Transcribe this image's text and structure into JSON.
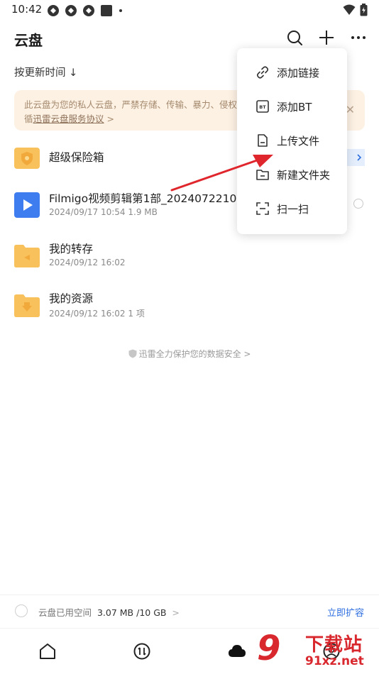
{
  "status_bar": {
    "time": "10:42"
  },
  "header": {
    "title": "云盘",
    "sort_label": "按更新时间 ↓"
  },
  "notice": {
    "line1": "此云盘为您的私人云盘，严禁存储、传输、暴力、侵权等",
    "line2_prefix": "循",
    "line2_link": "迅雷云盘服务协议",
    "line2_suffix": " >"
  },
  "files": [
    {
      "name": "超级保险箱",
      "meta": ""
    },
    {
      "name": "Filmigo视频剪辑第1部_202407221017",
      "meta": "2024/09/17 10:54  1.9 MB"
    },
    {
      "name": "我的转存",
      "meta": "2024/09/12 16:02"
    },
    {
      "name": "我的资源",
      "meta": "2024/09/12 16:02  1 项"
    }
  ],
  "secure_text": "迅雷全力保护您的数据安全 >",
  "menu": {
    "items": [
      {
        "label": "添加链接",
        "icon": "link-icon"
      },
      {
        "label": "添加BT",
        "icon": "bt-icon"
      },
      {
        "label": "上传文件",
        "icon": "upload-file-icon"
      },
      {
        "label": "新建文件夹",
        "icon": "new-folder-icon"
      },
      {
        "label": "扫一扫",
        "icon": "scan-icon"
      }
    ]
  },
  "storage": {
    "label": "云盘已用空间",
    "used": "3.07 MB /10 GB",
    "chevron": ">",
    "expand_label": "立即扩容"
  },
  "watermark": {
    "title": "下载站",
    "url": "91xz.net",
    "mark": "9"
  },
  "colors": {
    "accent": "#2f6fe0",
    "notice_bg": "#fdf1e3",
    "folder": "#f9c15b",
    "arrow": "#e0262d"
  }
}
